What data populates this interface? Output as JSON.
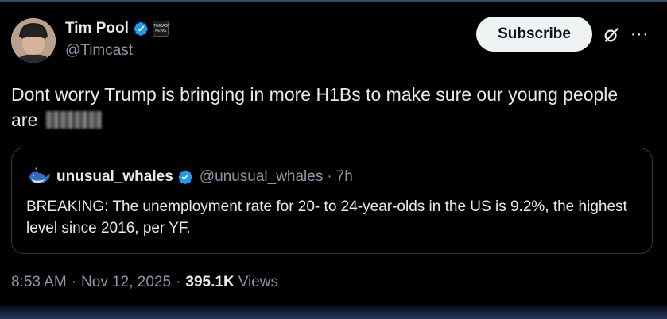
{
  "author": {
    "display_name": "Tim Pool",
    "handle": "@Timcast",
    "affiliate_badge": "TIMCAST NEWS"
  },
  "actions": {
    "subscribe_label": "Subscribe",
    "more_label": "···"
  },
  "tweet": {
    "text": "Dont worry Trump is bringing in more H1Bs to make sure our young people are"
  },
  "quote": {
    "display_name": "unusual_whales",
    "handle": "@unusual_whales",
    "separator": "·",
    "time": "7h",
    "text": "BREAKING: The unemployment rate for 20- to 24-year-olds in the US is 9.2%, the highest level since 2016, per YF."
  },
  "meta": {
    "time": "8:53 AM",
    "separator": "·",
    "date": "Nov 12, 2025",
    "views_count": "395.1K",
    "views_label": "Views"
  },
  "colors": {
    "background": "#000000",
    "text": "#e7e9ea",
    "secondary": "#8b98a5",
    "verified": "#1d9bf0",
    "border": "#333639",
    "button": "#eff3f4"
  },
  "icons": [
    "verified-badge-icon",
    "grok-icon",
    "more-icon",
    "whale-icon"
  ]
}
